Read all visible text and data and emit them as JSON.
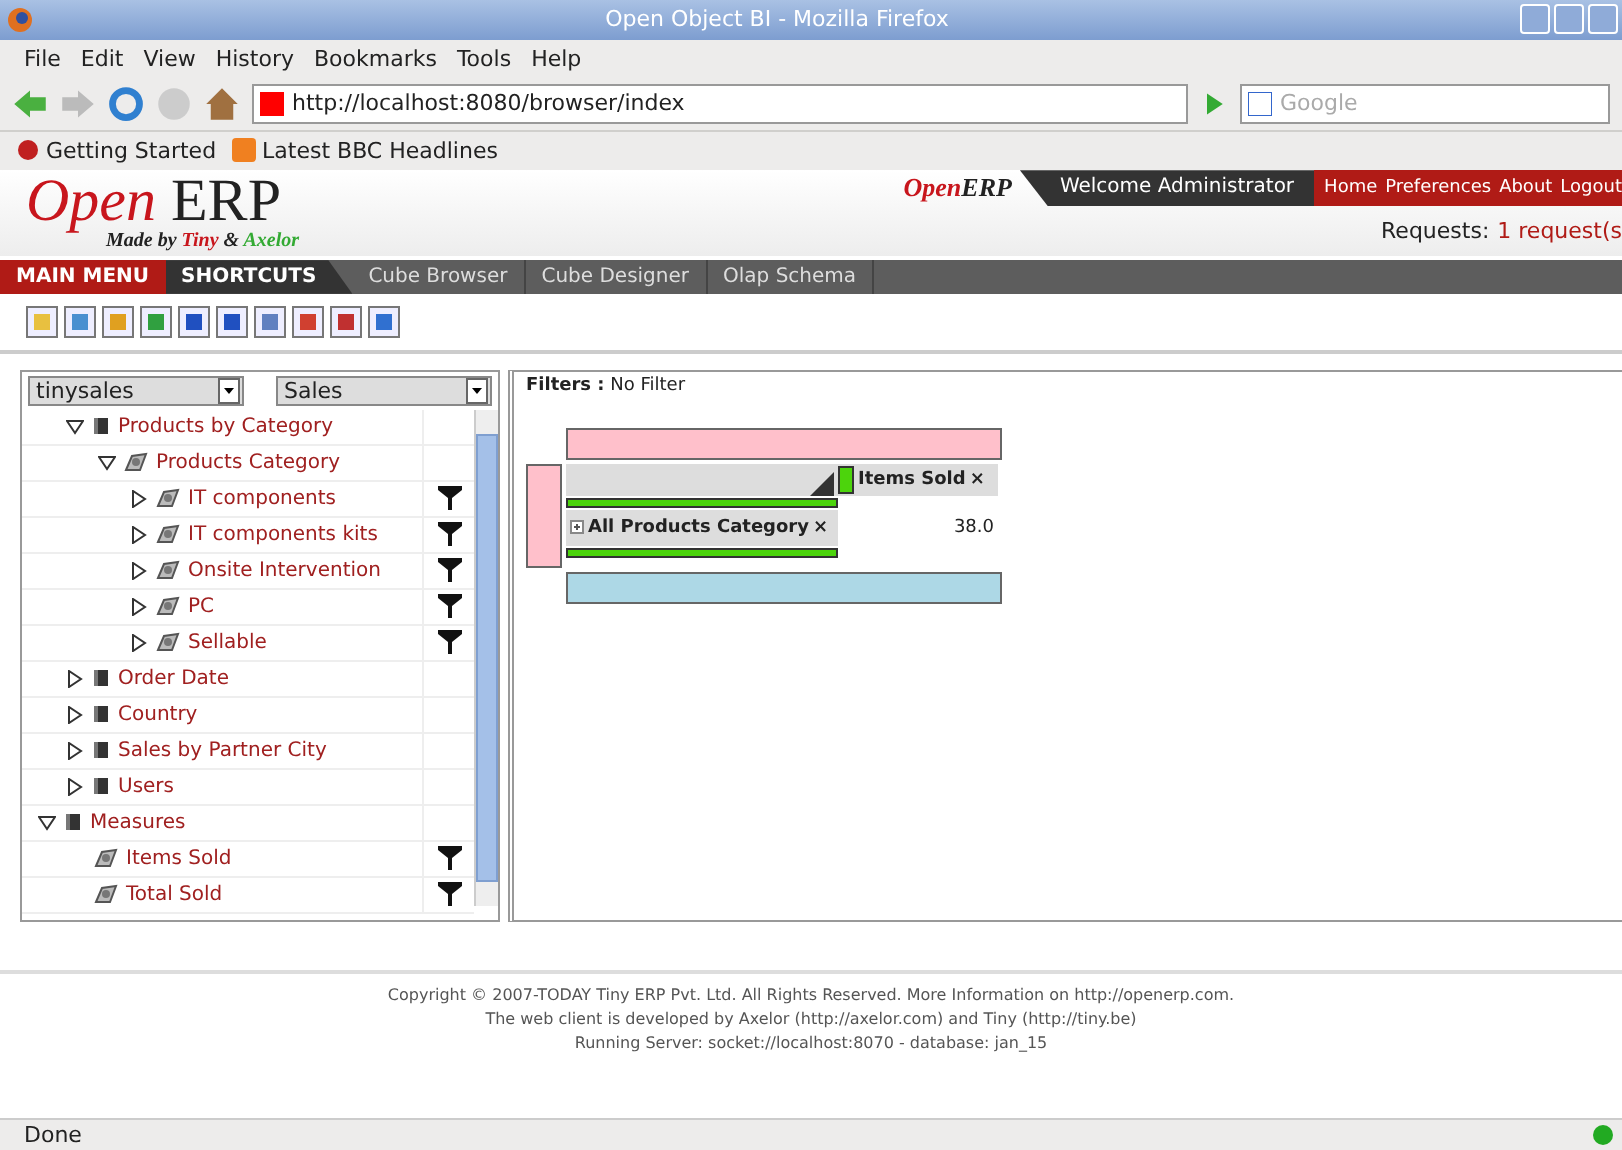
{
  "window": {
    "title": "Open Object BI - Mozilla Firefox"
  },
  "menu_bar": [
    "File",
    "Edit",
    "View",
    "History",
    "Bookmarks",
    "Tools",
    "Help"
  ],
  "nav_bar": {
    "url": "http://localhost:8080/browser/index",
    "search_placeholder": "Google"
  },
  "bookmarks": [
    {
      "label": "Getting Started",
      "kind": "page"
    },
    {
      "label": "Latest BBC Headlines",
      "kind": "feed"
    }
  ],
  "header": {
    "logo": {
      "open": "Open",
      "erp": "ERP",
      "made_by": "Made by",
      "tiny": "Tiny",
      "amp": "&",
      "axelor": "Axelor"
    },
    "small_logo": {
      "open": "Open",
      "erp": "ERP"
    },
    "welcome": "Welcome Administrator",
    "links": [
      "Home",
      "Preferences",
      "About",
      "Logout"
    ],
    "requests_label": "Requests:",
    "requests_value": "1 request(s"
  },
  "tabs": [
    {
      "label": "MAIN MENU",
      "kind": "main"
    },
    {
      "label": "SHORTCUTS",
      "kind": "shortcuts"
    },
    {
      "label": "Cube Browser",
      "kind": "link"
    },
    {
      "label": "Cube Designer",
      "kind": "link"
    },
    {
      "label": "Olap Schema",
      "kind": "link"
    }
  ],
  "left_panel": {
    "selects": [
      "tinysales",
      "Sales"
    ],
    "tree": [
      {
        "label": "Products by Category",
        "kind": "dimension",
        "expanded": true,
        "filter": false,
        "children": [
          {
            "label": "Products Category",
            "kind": "level",
            "expanded": true,
            "filter": false,
            "children": [
              {
                "label": "IT components",
                "kind": "level",
                "expanded": false,
                "filter": true
              },
              {
                "label": "IT components kits",
                "kind": "level",
                "expanded": false,
                "filter": true
              },
              {
                "label": "Onsite Intervention",
                "kind": "level",
                "expanded": false,
                "filter": true
              },
              {
                "label": "PC",
                "kind": "level",
                "expanded": false,
                "filter": true
              },
              {
                "label": "Sellable",
                "kind": "level",
                "expanded": false,
                "filter": true
              }
            ]
          }
        ]
      },
      {
        "label": "Order Date",
        "kind": "dimension",
        "expanded": false,
        "filter": false
      },
      {
        "label": "Country",
        "kind": "dimension",
        "expanded": false,
        "filter": false
      },
      {
        "label": "Sales by Partner City",
        "kind": "dimension",
        "expanded": false,
        "filter": false
      },
      {
        "label": "Users",
        "kind": "dimension",
        "expanded": false,
        "filter": false
      },
      {
        "label": "Measures",
        "kind": "root",
        "expanded": true,
        "filter": false,
        "children": [
          {
            "label": "Items Sold",
            "kind": "measure",
            "filter": true
          },
          {
            "label": "Total Sold",
            "kind": "measure",
            "filter": true
          }
        ]
      }
    ]
  },
  "right_panel": {
    "filters_label": "Filters :",
    "filters_value": "No Filter",
    "pivot": {
      "measure": "Items Sold",
      "measure_close": "×",
      "row": "All Products Category",
      "row_close": "×",
      "value": "38.0"
    }
  },
  "footer": [
    [
      {
        "text": "Copyright © 2007-TODAY Tiny ERP Pvt. Ltd. All Rights Reserved. More Information on "
      },
      {
        "link": "http://openerp.com"
      },
      {
        "text": "."
      }
    ],
    [
      {
        "text": "The web client is developed by Axelor ("
      },
      {
        "link": "http://axelor.com"
      },
      {
        "text": ") and Tiny ("
      },
      {
        "link": "http://tiny.be"
      },
      {
        "text": ")"
      }
    ],
    [
      {
        "text": "Running Server: socket://localhost:8070 - database: jan_15"
      }
    ]
  ],
  "status_bar": {
    "text": "Done"
  }
}
